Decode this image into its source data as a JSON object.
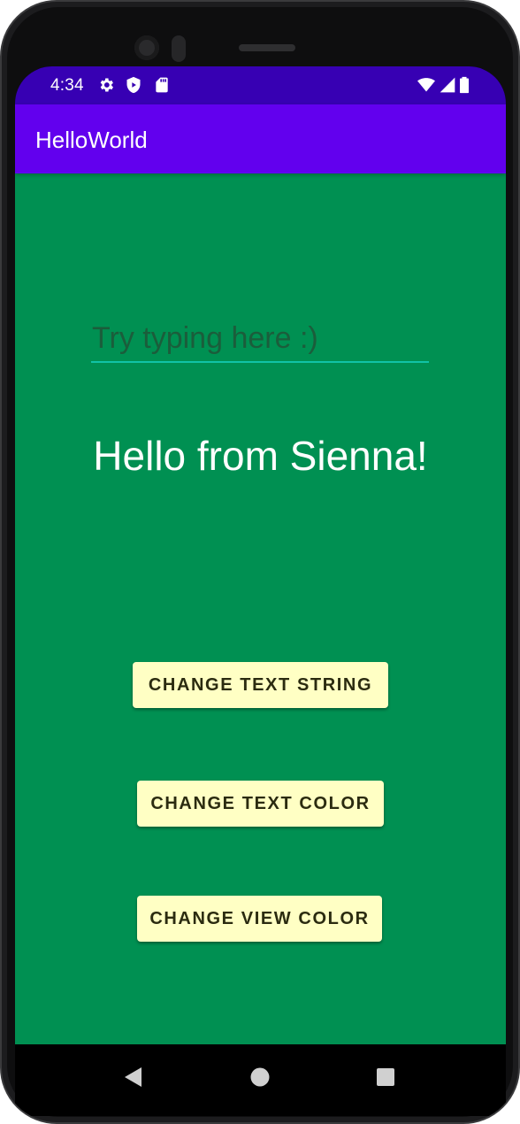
{
  "status_bar": {
    "time": "4:34",
    "left_icons": [
      "settings-icon",
      "shield-icon",
      "sd-card-icon"
    ],
    "right_icons": [
      "wifi-icon",
      "cellular-signal-icon",
      "battery-icon"
    ],
    "background": "#3700b3"
  },
  "app_bar": {
    "title": "HelloWorld",
    "background": "#6200ee"
  },
  "main": {
    "background": "#009052",
    "input": {
      "value": "",
      "placeholder": "Try typing here :)",
      "underline_color": "#11c3a6"
    },
    "greeting": "Hello from Sienna!",
    "buttons": [
      {
        "label": "CHANGE TEXT STRING"
      },
      {
        "label": "CHANGE TEXT COLOR"
      },
      {
        "label": "CHANGE VIEW COLOR"
      }
    ],
    "button_color": "#ffffc4"
  },
  "nav_bar": {
    "buttons": [
      "back-icon",
      "home-icon",
      "recents-icon"
    ]
  }
}
